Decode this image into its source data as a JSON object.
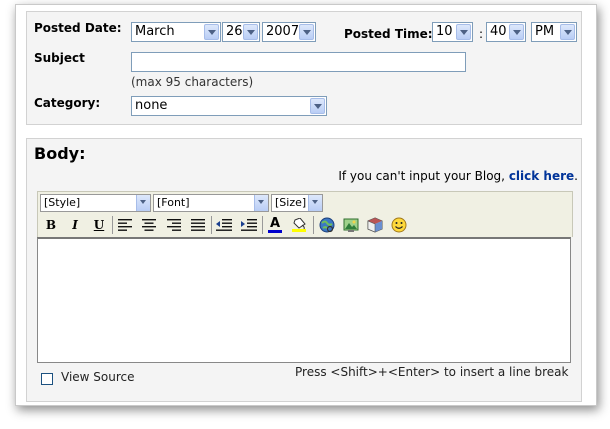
{
  "posted": {
    "date_label": "Posted Date:",
    "month": "March",
    "day": "26",
    "year": "2007",
    "time_label": "Posted Time:",
    "hour": "10",
    "colon": ":",
    "minute": "40",
    "ampm": "PM"
  },
  "subject": {
    "label": "Subject",
    "value": "",
    "hint": "(max 95 characters)"
  },
  "category": {
    "label": "Category:",
    "value": "none"
  },
  "body": {
    "label": "Body:",
    "fallback_text": "If you can't input your Blog,",
    "fallback_link": "click here",
    "fallback_period": "."
  },
  "toolbar": {
    "style": "[Style]",
    "font": "[Font]",
    "size": "[Size]",
    "bold": "B",
    "italic": "I",
    "underline": "U",
    "font_color_glyph": "A",
    "font_color": "#0000cc",
    "highlight_color": "#ffff00",
    "link_color": "#003399"
  },
  "footer": {
    "view_source": "View Source",
    "line_break_hint": "Press <Shift>+<Enter> to insert a line break"
  }
}
